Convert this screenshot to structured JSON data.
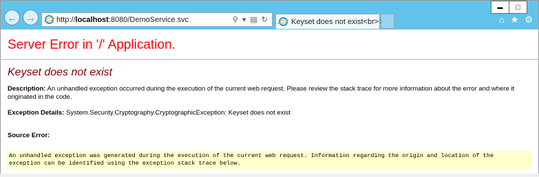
{
  "browser": {
    "address": {
      "prefix": "http://",
      "host": "localhost",
      "rest": ":8080/DemoService.svc"
    },
    "tab": {
      "title": "Keyset does not exist<br>",
      "close_glyph": "✕"
    },
    "window_buttons": {
      "minimize": "▬",
      "maximize": "□"
    },
    "nav": {
      "back": "←",
      "forward": "→"
    },
    "address_tools": {
      "search": "⚲",
      "dropdown": "▾",
      "compat": "▤",
      "refresh": "↻"
    },
    "right_icons": {
      "home": "⌂",
      "favorites": "★",
      "settings": "⚙"
    }
  },
  "page": {
    "heading": "Server Error in '/' Application.",
    "error_title": "Keyset does not exist",
    "description_label": "Description:",
    "description_text": " An unhandled exception occurred during the execution of the current web request. Please review the stack trace for more information about the error and where it originated in the code.",
    "exception_label": "Exception Details:",
    "exception_text": " System.Security.Cryptography.CryptographicException: Keyset does not exist",
    "source_label": "Source Error:",
    "source_line1": "An unhandled exception was generated during the execution of the current web request. Information regarding the origin and location of the",
    "source_line2": "exception can be identified using the exception stack trace below."
  }
}
